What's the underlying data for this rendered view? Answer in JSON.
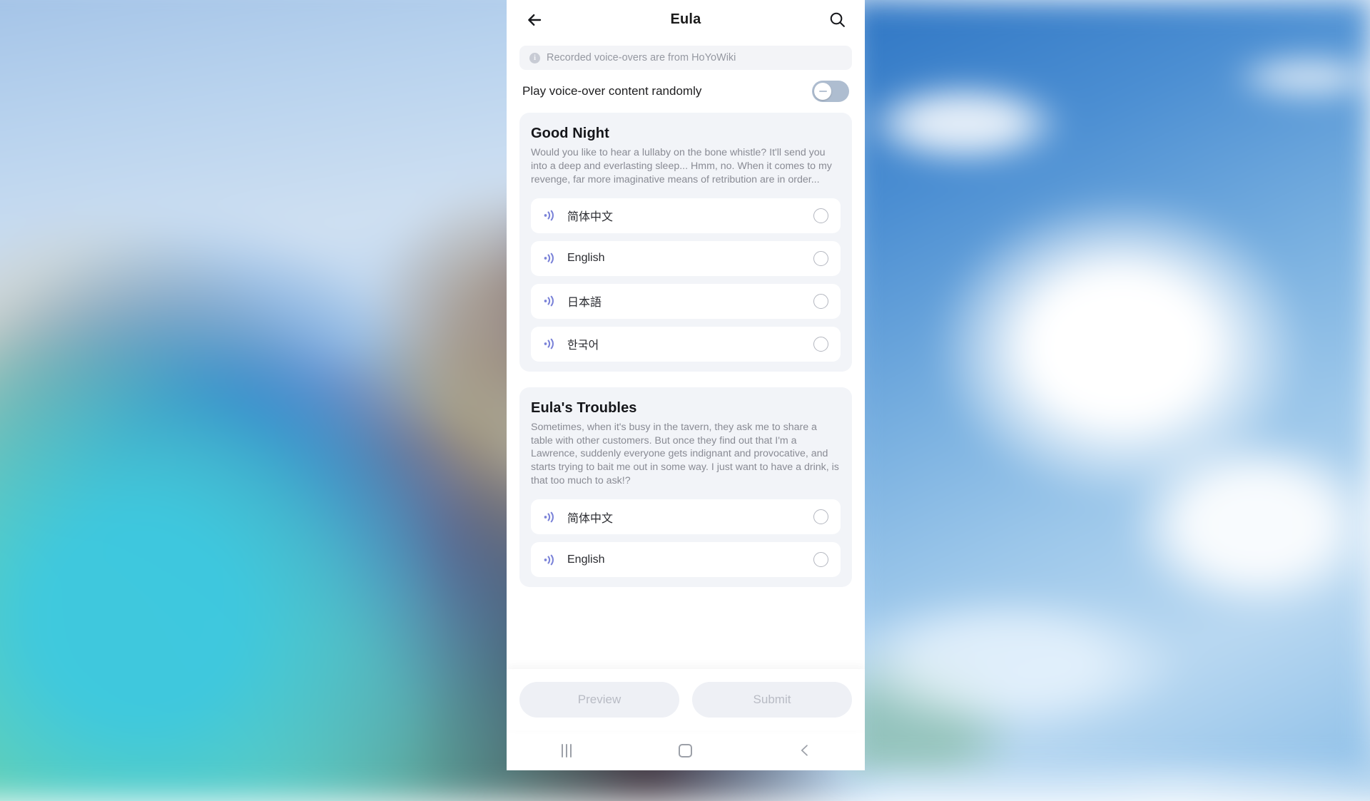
{
  "app": {
    "title": "Eula",
    "back_icon": "arrow-left-icon",
    "search_icon": "search-icon"
  },
  "notice": {
    "icon": "info-icon",
    "text": "Recorded voice-overs are from HoYoWiki"
  },
  "random_toggle": {
    "label": "Play voice-over content randomly",
    "state": "off"
  },
  "voiceover_groups": [
    {
      "title": "Good Night",
      "description": "Would you like to hear a lullaby on the bone whistle? It'll send you into a deep and everlasting sleep... Hmm, no. When it comes to my revenge, far more imaginative means of retribution are in order...",
      "languages": [
        {
          "label": "简体中文",
          "icon": "speaker-wave-icon",
          "selected": false
        },
        {
          "label": "English",
          "icon": "speaker-wave-icon",
          "selected": false
        },
        {
          "label": "日本語",
          "icon": "speaker-wave-icon",
          "selected": false
        },
        {
          "label": "한국어",
          "icon": "speaker-wave-icon",
          "selected": false
        }
      ]
    },
    {
      "title": "Eula's Troubles",
      "description": "Sometimes, when it's busy in the tavern, they ask me to share a table with other customers. But once they find out that I'm a Lawrence, suddenly everyone gets indignant and provocative, and starts trying to bait me out in some way. I just want to have a drink, is that too much to ask!?",
      "languages": [
        {
          "label": "简体中文",
          "icon": "speaker-wave-icon",
          "selected": false
        },
        {
          "label": "English",
          "icon": "speaker-wave-icon",
          "selected": false
        }
      ]
    }
  ],
  "actions": {
    "preview_label": "Preview",
    "submit_label": "Submit"
  },
  "navbar": {
    "recents_icon": "recents-icon",
    "home_icon": "home-icon",
    "back_icon": "chevron-left-icon"
  },
  "colors": {
    "accent": "#7b83d8",
    "card_bg": "#f2f4f8",
    "row_bg": "#ffffff",
    "toggle_track": "#aebdd0",
    "muted_text": "#898b94",
    "disabled_btn_bg": "#eef0f5",
    "disabled_btn_text": "#b8bbc4"
  }
}
